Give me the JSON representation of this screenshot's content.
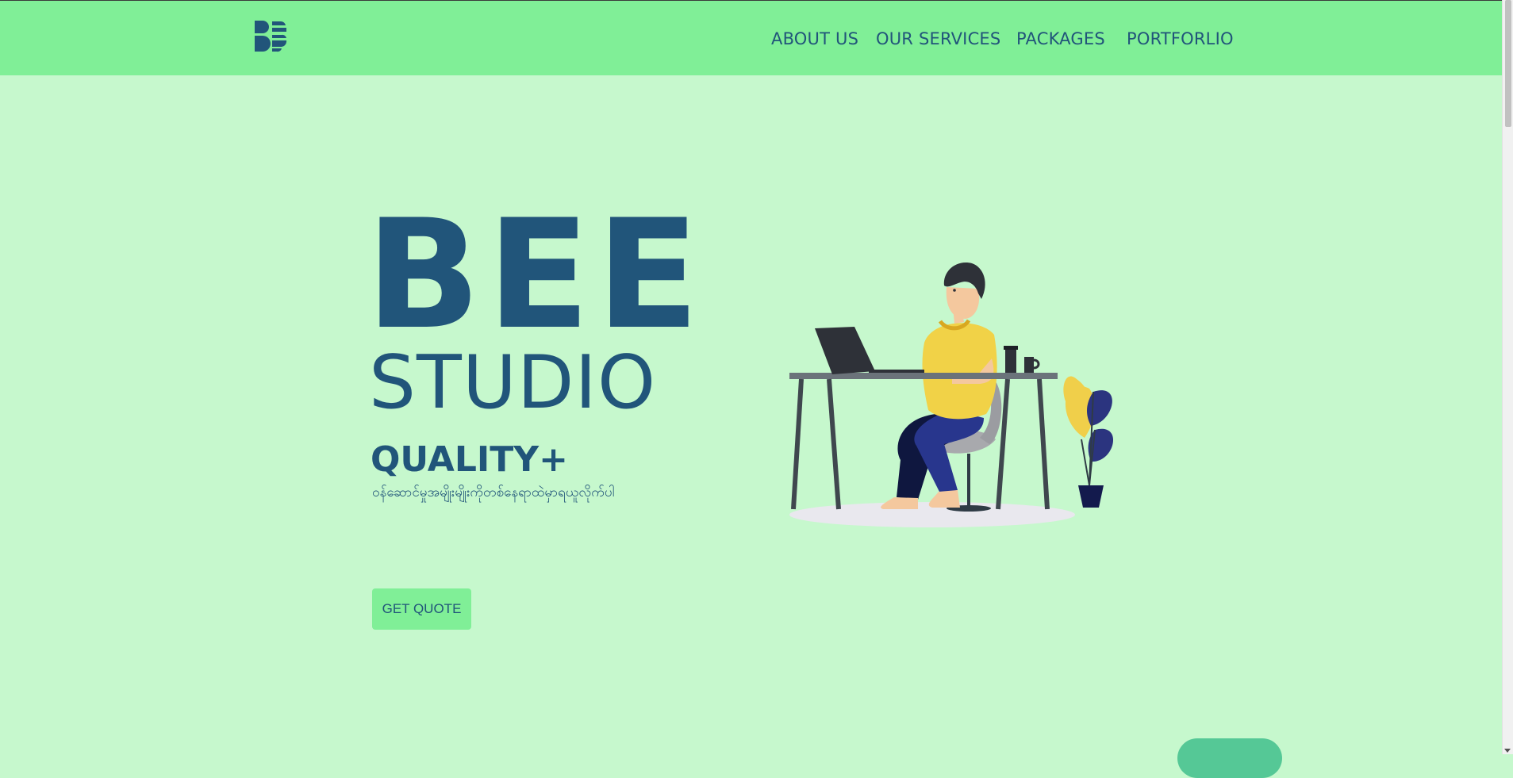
{
  "brand": {
    "logo_icon": "bee-studio-logo-icon"
  },
  "nav": {
    "items": [
      {
        "label": "ABOUT US"
      },
      {
        "label": "OUR SERVICES"
      },
      {
        "label": "PACKAGES"
      },
      {
        "label": "PORTFORLIO"
      }
    ]
  },
  "hero": {
    "title_line1": "BEE",
    "title_line2": "STUDIO",
    "subtitle": "QUALITY+",
    "tagline": "ဝန်ဆောင်မှုအမျိုးမျိုးကိုတစ်နေရာထဲမှာရယူလိုက်ပါ",
    "cta_label": "GET QUOTE",
    "illustration_icon": "person-at-desk-illustration-icon"
  },
  "colors": {
    "background": "#c6f8cd",
    "nav_background": "#80ef97",
    "primary_text": "#21557a",
    "button": "#80ef97",
    "accent_pill": "#55c896"
  }
}
